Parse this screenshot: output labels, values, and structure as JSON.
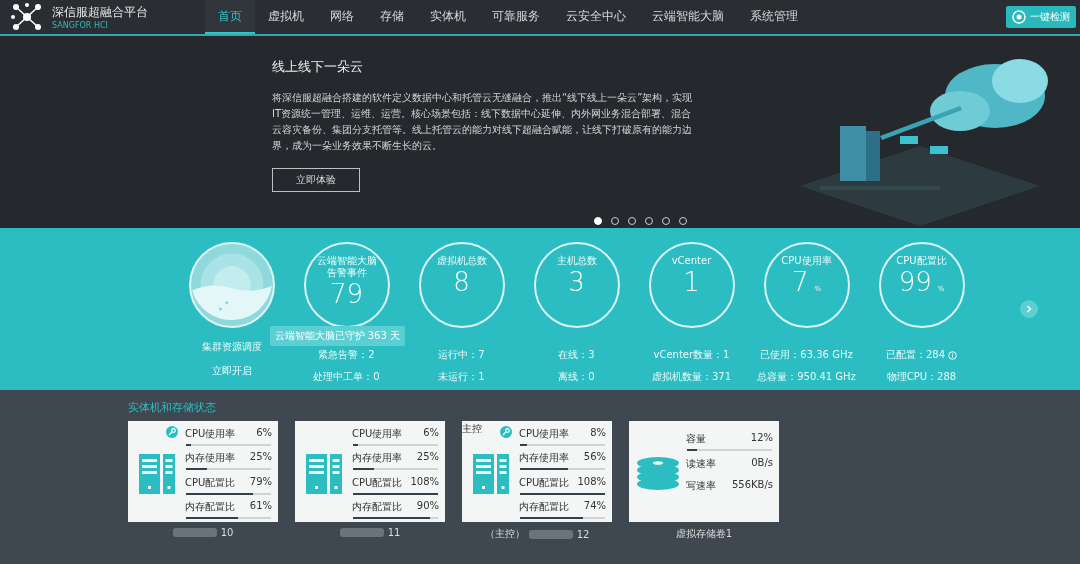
{
  "header": {
    "title": "深信服超融合平台",
    "subtitle": "SANGFOR HCI",
    "nav": [
      {
        "label": "首页",
        "selected": true
      },
      {
        "label": "虚拟机",
        "selected": false
      },
      {
        "label": "网络",
        "selected": false
      },
      {
        "label": "存储",
        "selected": false
      },
      {
        "label": "实体机",
        "selected": false
      },
      {
        "label": "可靠服务",
        "selected": false
      },
      {
        "label": "云安全中心",
        "selected": false
      },
      {
        "label": "云端智能大脑",
        "selected": false
      },
      {
        "label": "系统管理",
        "selected": false
      }
    ],
    "check_button": "一键检测"
  },
  "banner": {
    "title": "线上线下一朵云",
    "text": "将深信服超融合搭建的软件定义数据中心和托管云无缝融合，推出“线下线上一朵云”架构，实现IT资源统一管理、运维、运营。核心场景包括：线下数据中心延伸、内外网业务混合部署、混合云容灾备份、集团分支托管等。线上托管云的能力对线下超融合赋能，让线下打破原有的能力边界，成为一朵业务效果不断生长的云。",
    "button": "立即体验",
    "slides": [
      {
        "selected": true
      },
      {
        "selected": false
      },
      {
        "selected": false
      },
      {
        "selected": false
      },
      {
        "selected": false
      },
      {
        "selected": false
      }
    ]
  },
  "stats": [
    {
      "kind": "gauge",
      "label": "集群资源调度",
      "link": "立即开启"
    },
    {
      "kind": "circle",
      "title": "云端智能大脑告警事件",
      "value": "79",
      "tooltip": "云端智能大脑已守护 363 天",
      "lines": [
        "紧急告警：2",
        "处理中工单：0"
      ]
    },
    {
      "kind": "circle",
      "title": "虚拟机总数",
      "value": "8",
      "lines": [
        "运行中：7",
        "未运行：1"
      ]
    },
    {
      "kind": "circle",
      "title": "主机总数",
      "value": "3",
      "lines": [
        "在线：3",
        "离线：0"
      ]
    },
    {
      "kind": "circle",
      "title": "vCenter",
      "value": "1",
      "lines": [
        "vCenter数量：1",
        "虚拟机数量：371"
      ]
    },
    {
      "kind": "circle",
      "title": "CPU使用率",
      "value": "7",
      "unit": "%",
      "lines": [
        "已使用：63.36 GHz",
        "总容量：950.41 GHz"
      ]
    },
    {
      "kind": "circle",
      "title": "CPU配置比",
      "value": "99",
      "unit": "%",
      "info_icon": true,
      "lines": [
        "已配置：284",
        "物理CPU：288"
      ]
    }
  ],
  "status": {
    "title": "实体机和存储状态",
    "cards": [
      {
        "kind": "host",
        "key_icon": true,
        "label": "10",
        "metrics": [
          {
            "name": "CPU使用率",
            "reading": "6%",
            "level": 0.06
          },
          {
            "name": "内存使用率",
            "reading": "25%",
            "level": 0.25
          },
          {
            "name": "CPU配置比",
            "reading": "79%",
            "level": 0.79
          },
          {
            "name": "内存配置比",
            "reading": "61%",
            "level": 0.61
          }
        ]
      },
      {
        "kind": "host",
        "key_icon": false,
        "label": "11",
        "metrics": [
          {
            "name": "CPU使用率",
            "reading": "6%",
            "level": 0.06
          },
          {
            "name": "内存使用率",
            "reading": "25%",
            "level": 0.25
          },
          {
            "name": "CPU配置比",
            "reading": "108%",
            "level": 1
          },
          {
            "name": "内存配置比",
            "reading": "90%",
            "level": 0.9
          }
        ]
      },
      {
        "kind": "host",
        "key_icon": true,
        "badge": "主控",
        "prefix": "（主控）",
        "label": "12",
        "metrics": [
          {
            "name": "CPU使用率",
            "reading": "8%",
            "level": 0.08
          },
          {
            "name": "内存使用率",
            "reading": "56%",
            "level": 0.56
          },
          {
            "name": "CPU配置比",
            "reading": "108%",
            "level": 1
          },
          {
            "name": "内存配置比",
            "reading": "74%",
            "level": 0.74
          }
        ]
      },
      {
        "kind": "storage",
        "label": "虚拟存储卷1",
        "metrics": [
          {
            "name": "容量",
            "reading": "12%",
            "level": 0.12
          },
          {
            "name": "读速率",
            "reading": "0B/s"
          },
          {
            "name": "写速率",
            "reading": "556KB/s"
          }
        ]
      }
    ]
  }
}
